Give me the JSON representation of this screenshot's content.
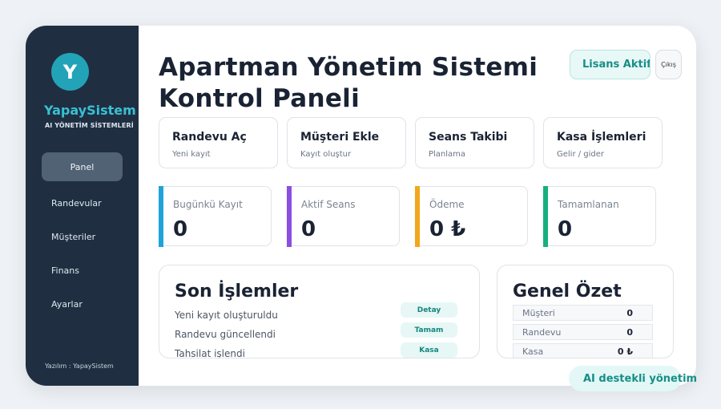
{
  "sidebar": {
    "logo_letter": "Y",
    "brand_name": "YapaySistem",
    "brand_subtitle": "AI YÖNETİM SİSTEMLERİ",
    "items": [
      {
        "label": "Panel",
        "active": true
      },
      {
        "label": "Randevular",
        "active": false
      },
      {
        "label": "Müşteriler",
        "active": false
      },
      {
        "label": "Finans",
        "active": false
      },
      {
        "label": "Ayarlar",
        "active": false
      }
    ],
    "footer": "Yazılım : YapaySistem"
  },
  "header": {
    "title_line1": "Apartman Yönetim Sistemi",
    "title_line2": "Kontrol Paneli",
    "license_label": "Lisans Aktif",
    "logout_label": "Çıkış"
  },
  "quick_actions": [
    {
      "title": "Randevu Aç",
      "subtitle": "Yeni kayıt"
    },
    {
      "title": "Müşteri Ekle",
      "subtitle": "Kayıt oluştur"
    },
    {
      "title": "Seans Takibi",
      "subtitle": "Planlama"
    },
    {
      "title": "Kasa İşlemleri",
      "subtitle": "Gelir / gider"
    }
  ],
  "stats": [
    {
      "label": "Bugünkü Kayıt",
      "value": "0",
      "color": "#1fa3d8"
    },
    {
      "label": "Aktif Seans",
      "value": "0",
      "color": "#8a4fe0"
    },
    {
      "label": "Ödeme",
      "value": "0 ₺",
      "color": "#f2a81d"
    },
    {
      "label": "Tamamlanan",
      "value": "0",
      "color": "#16b07f"
    }
  ],
  "recent": {
    "title": "Son İşlemler",
    "items": [
      {
        "text": "Yeni kayıt oluşturuldu",
        "badge": "Detay"
      },
      {
        "text": "Randevu güncellendi",
        "badge": "Tamam"
      },
      {
        "text": "Tahsilat işlendi",
        "badge": "Kasa"
      }
    ]
  },
  "summary": {
    "title": "Genel Özet",
    "rows": [
      {
        "label": "Müşteri",
        "value": "0"
      },
      {
        "label": "Randevu",
        "value": "0"
      },
      {
        "label": "Kasa",
        "value": "0 ₺"
      }
    ]
  },
  "ai_badge": "AI destekli yönetim",
  "colors": {
    "sidebar_bg": "#1f2f41",
    "accent": "#22a3b8",
    "brand_text": "#39c0d3",
    "teal_text": "#168f86"
  }
}
